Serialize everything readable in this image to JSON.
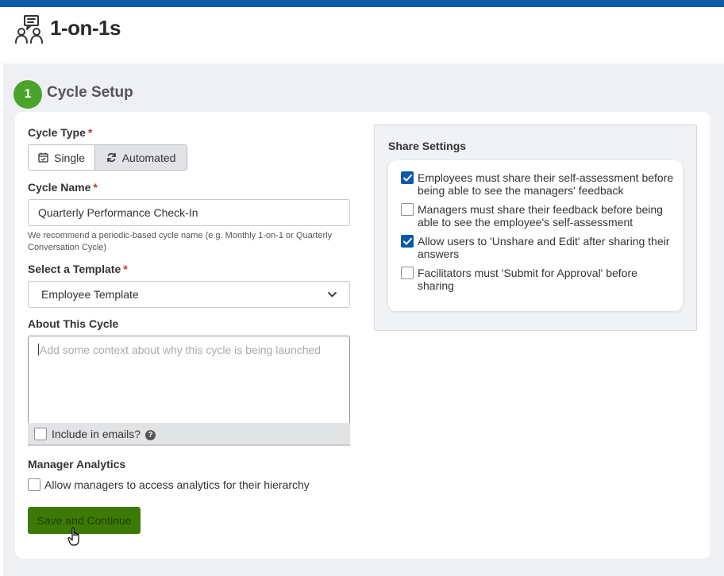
{
  "header": {
    "title": "1-on-1s",
    "icon": "users-chat-icon"
  },
  "step": {
    "number": "1",
    "title": "Cycle Setup"
  },
  "form": {
    "cycle_type": {
      "label": "Cycle Type",
      "required_mark": "*",
      "options": [
        {
          "label": "Single",
          "icon": "calendar-check-icon",
          "selected": false
        },
        {
          "label": "Automated",
          "icon": "refresh-icon",
          "selected": true
        }
      ]
    },
    "cycle_name": {
      "label": "Cycle Name",
      "required_mark": "*",
      "value": "Quarterly Performance Check-In",
      "hint": "We recommend a periodic-based cycle name (e.g. Monthly 1-on-1 or Quarterly Conversation Cycle)"
    },
    "template": {
      "label": "Select a Template",
      "required_mark": "*",
      "selected": "Employee Template"
    },
    "about": {
      "label": "About This Cycle",
      "placeholder": "Add some context about why this cycle is being launched",
      "include_emails_label": "Include in emails?",
      "include_emails_checked": false
    },
    "manager_analytics": {
      "label": "Manager Analytics",
      "checkbox_label": "Allow managers to access analytics for their hierarchy",
      "checked": false
    },
    "save_label": "Save and Continue"
  },
  "share": {
    "title": "Share Settings",
    "items": [
      {
        "label": "Employees must share their self-assessment before being able to see the managers' feedback",
        "checked": true
      },
      {
        "label": "Managers must share their feedback before being able to see the employee's self-assessment",
        "checked": false
      },
      {
        "label": "Allow users to 'Unshare and Edit' after sharing their answers",
        "checked": true
      },
      {
        "label": "Facilitators must 'Submit for Approval' before sharing",
        "checked": false
      }
    ]
  },
  "colors": {
    "top_bar": "#0a5aa8",
    "step_badge": "#4aa32a",
    "save_button": "#3d7a05",
    "checkbox_checked": "#0a5aa8"
  }
}
